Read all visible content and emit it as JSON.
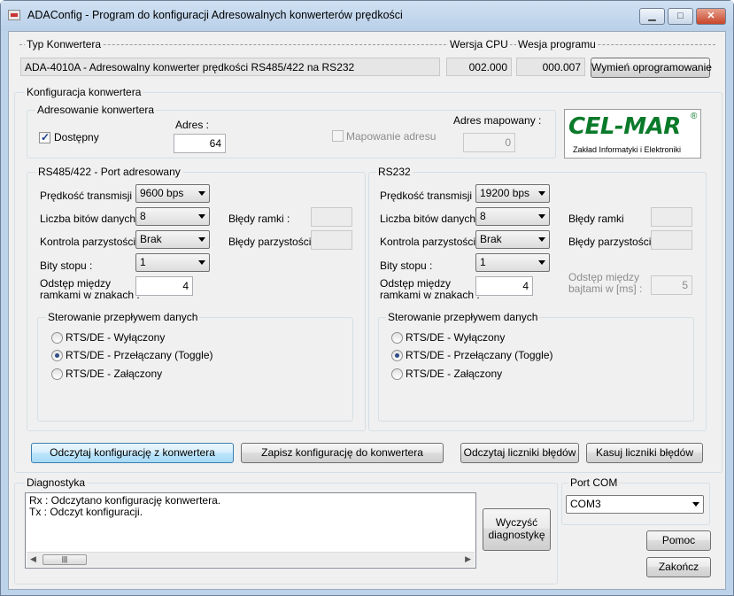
{
  "window": {
    "title": "ADAConfig - Program do konfiguracji Adresowalnych konwerterów prędkości"
  },
  "device": {
    "type_label": "Typ Konwertera",
    "cpu_label": "Wersja CPU",
    "program_label": "Wesja programu",
    "type_value": "ADA-4010A - Adresowalny konwerter prędkości RS485/422 na RS232",
    "cpu_value": "002.000",
    "program_value": "000.007",
    "update_button": "Wymień oprogramowanie"
  },
  "config": {
    "group_label": "Konfiguracja konwertera"
  },
  "addressing": {
    "group_label": "Adresowanie konwertera",
    "available_label": "Dostępny",
    "available_checked": true,
    "address_label": "Adres :",
    "address_value": "64",
    "mapping_label": "Mapowanie adresu",
    "mapping_checked": false,
    "mapped_label": "Adres mapowany :",
    "mapped_value": "0"
  },
  "logo": {
    "brand": "CEL-MAR",
    "subtitle": "Zakład Informatyki i Elektroniki",
    "color": "#0a7a2a"
  },
  "rs485": {
    "group_label": "RS485/422 - Port adresowany",
    "speed_label": "Prędkość transmisji :",
    "speed_value": "9600 bps",
    "databits_label": "Liczba bitów danych :",
    "databits_value": "8",
    "parity_label": "Kontrola parzystości :",
    "parity_value": "Brak",
    "stopbits_label": "Bity stopu :",
    "stopbits_value": "1",
    "gap_label_1": "Odstęp między",
    "gap_label_2": "ramkami w znakach :",
    "gap_value": "4",
    "frame_err_label": "Błędy ramki :",
    "parity_err_label": "Błędy parzystości :",
    "flow": {
      "group_label": "Sterowanie przepływem danych",
      "options": [
        "RTS/DE - Wyłączony",
        "RTS/DE - Przełączany (Toggle)",
        "RTS/DE - Załączony"
      ],
      "selected": 1
    }
  },
  "rs232": {
    "group_label": "RS232",
    "speed_label": "Prędkość transmisji :",
    "speed_value": "19200 bps",
    "databits_label": "Liczba bitów danych :",
    "databits_value": "8",
    "parity_label": "Kontrola parzystości :",
    "parity_value": "Brak",
    "stopbits_label": "Bity stopu :",
    "stopbits_value": "1",
    "gap_label_1": "Odstęp między",
    "gap_label_2": "ramkami w znakach :",
    "gap_value": "4",
    "frame_err_label": "Błędy ramki",
    "parity_err_label": "Błędy parzystości",
    "byte_gap_label_1": "Odstęp między",
    "byte_gap_label_2": "bajtami w [ms] :",
    "byte_gap_value": "5",
    "flow": {
      "group_label": "Sterowanie przepływem danych",
      "options": [
        "RTS/DE - Wyłączony",
        "RTS/DE - Przełączany (Toggle)",
        "RTS/DE - Załączony"
      ],
      "selected": 1
    }
  },
  "actions": {
    "read_config": "Odczytaj konfigurację z konwertera",
    "write_config": "Zapisz konfigurację do konwertera",
    "read_errors": "Odczytaj liczniki błędów",
    "clear_errors": "Kasuj liczniki błędów"
  },
  "diagnostics": {
    "group_label": "Diagnostyka",
    "lines": [
      "Rx : Odczytano konfigurację konwertera.",
      "Tx : Odczyt konfiguracji."
    ],
    "clear_button_1": "Wyczyść",
    "clear_button_2": "diagnostykę"
  },
  "port": {
    "group_label": "Port COM",
    "value": "COM3"
  },
  "footer": {
    "help_button": "Pomoc",
    "exit_button": "Zakończ"
  }
}
